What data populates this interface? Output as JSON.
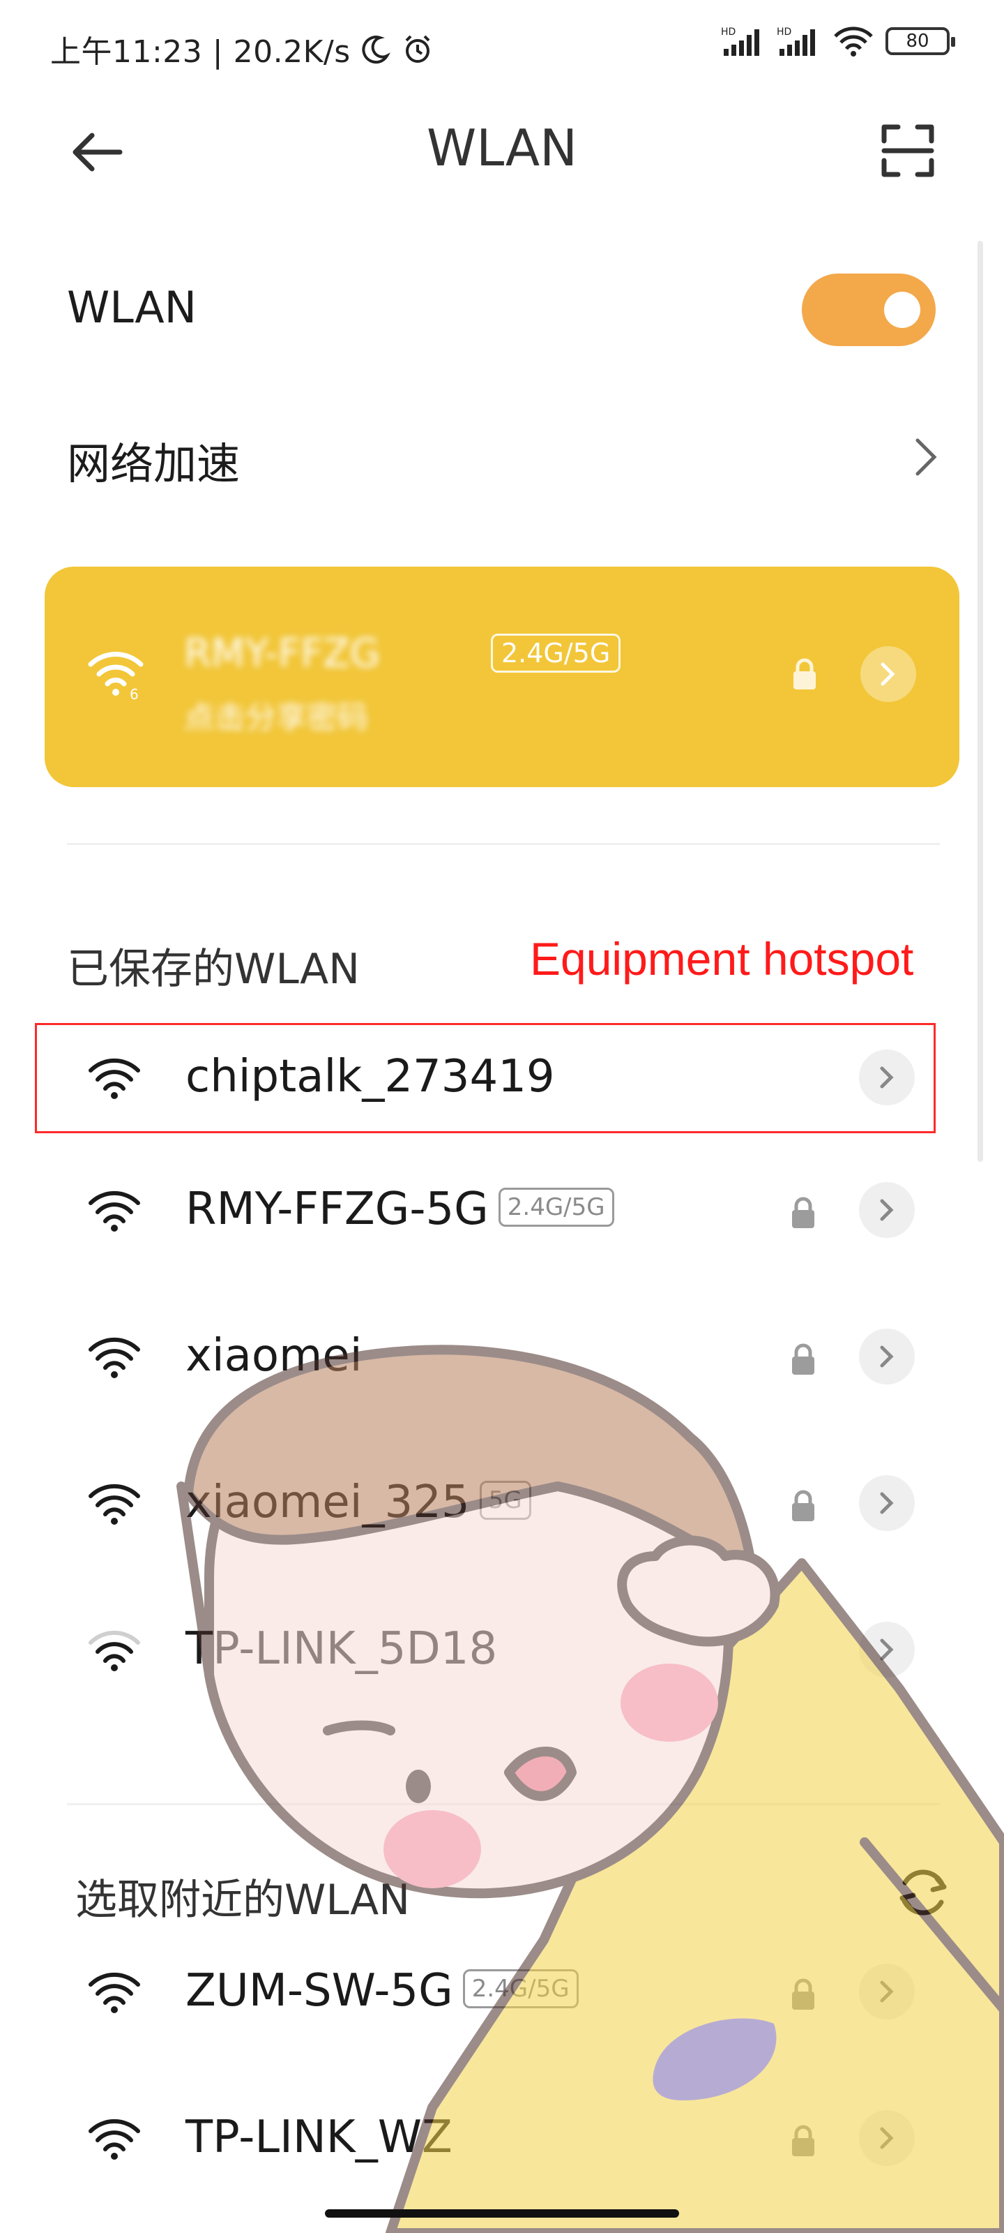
{
  "status_bar": {
    "time_speed": "上午11:23 | 20.2K/s",
    "battery": "80"
  },
  "header": {
    "title": "WLAN",
    "back_icon": "arrow-left-icon",
    "scan_icon": "scan-frame-icon"
  },
  "wlan_toggle": {
    "label": "WLAN",
    "enabled": true,
    "accent": "#f3a84a"
  },
  "network_accel": {
    "label": "网络加速"
  },
  "connected": {
    "ssid": "RMY-FFZG",
    "band": "2.4G/5G",
    "status": "点击分享密码",
    "card_color": "#f2c638"
  },
  "saved_section": {
    "title": "已保存的WLAN",
    "annotation": "Equipment hotspot",
    "annotation_color": "#ff1a1a",
    "networks": [
      {
        "ssid": "chiptalk_273419",
        "band": "",
        "locked": false
      },
      {
        "ssid": "RMY-FFZG-5G",
        "band": "2.4G/5G",
        "locked": true
      },
      {
        "ssid": "xiaomei",
        "band": "",
        "locked": true
      },
      {
        "ssid": "xiaomei_325",
        "band": "5G",
        "locked": true
      },
      {
        "ssid": "TP-LINK_5D18",
        "band": "",
        "locked": false
      }
    ]
  },
  "nearby_section": {
    "title": "选取附近的WLAN",
    "refresh_icon": "refresh-icon",
    "networks": [
      {
        "ssid": "ZUM-SW-5G",
        "band": "2.4G/5G",
        "locked": true
      },
      {
        "ssid": "TP-LINK_WZ",
        "band": "",
        "locked": true
      }
    ]
  }
}
